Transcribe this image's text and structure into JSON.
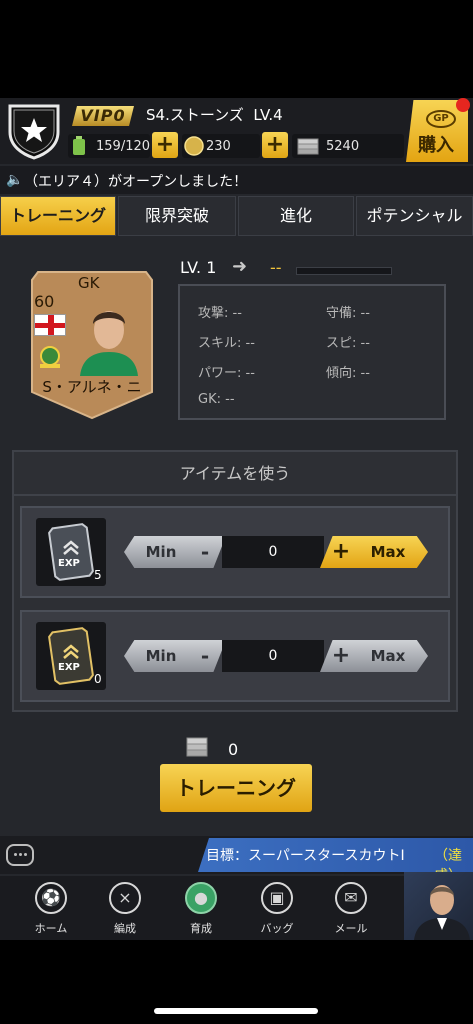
{
  "header": {
    "vip_label": "VIP0",
    "team_name": "S4.ストーンズ",
    "team_level": "LV.4",
    "stamina": "159/120",
    "coins": "230",
    "cash": "5240",
    "buy_label": "購入",
    "gp_label": "GP"
  },
  "ticker": {
    "text": "（エリア４）がオープンしました！"
  },
  "tabs": [
    {
      "label": "トレーニング"
    },
    {
      "label": "限界突破"
    },
    {
      "label": "進化"
    },
    {
      "label": "ポテンシャル"
    }
  ],
  "player": {
    "position": "GK",
    "rating": "60",
    "name": "S・アルネ・ニ",
    "level": "LV. 1",
    "next_level": "--"
  },
  "stats": [
    {
      "label": "攻撃:",
      "value": "--"
    },
    {
      "label": "守備:",
      "value": "--"
    },
    {
      "label": "スキル:",
      "value": "--"
    },
    {
      "label": "スピ:",
      "value": "--"
    },
    {
      "label": "パワー:",
      "value": "--"
    },
    {
      "label": "傾向:",
      "value": "--"
    },
    {
      "label": "GK:",
      "value": "--"
    }
  ],
  "items": {
    "title": "アイテムを使う",
    "rows": [
      {
        "icon_text": "EXP",
        "count": "5",
        "min_label": "Min",
        "minus": "-",
        "quantity": "0",
        "plus": "+",
        "max_label": "Max"
      },
      {
        "icon_text": "EXP",
        "count": "0",
        "min_label": "Min",
        "minus": "-",
        "quantity": "0",
        "plus": "+",
        "max_label": "Max"
      }
    ]
  },
  "training": {
    "cost": "0",
    "button_label": "トレーニング"
  },
  "mission": {
    "text": "目標：スーパースタースカウトⅠ",
    "status": "（達成）"
  },
  "nav": [
    {
      "label": "ホーム"
    },
    {
      "label": "編成"
    },
    {
      "label": "育成"
    },
    {
      "label": "バッグ"
    },
    {
      "label": "メール"
    }
  ],
  "colors": {
    "accent": "#f3c53b",
    "background": "#25272c",
    "nav_active": "#3aa265",
    "mission": "#3c6fc1"
  }
}
